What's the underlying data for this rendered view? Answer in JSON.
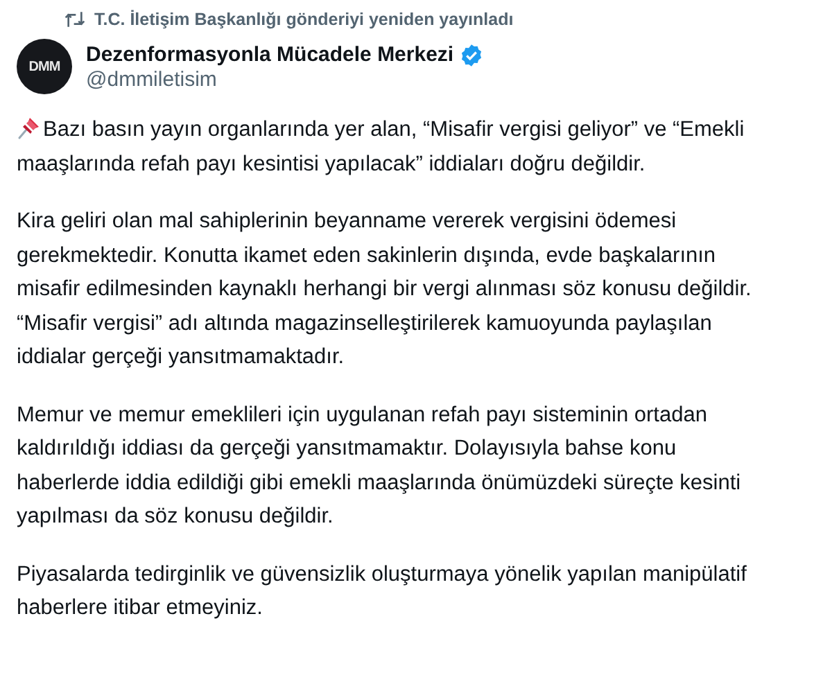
{
  "repost": {
    "text": "T.C. İletişim Başkanlığı gönderiyi yeniden yayınladı"
  },
  "author": {
    "avatar_text": "DMM",
    "name": "Dezenformasyonla Mücadele Merkezi",
    "verified": true,
    "handle": "@dmmiletisim"
  },
  "paragraphs": [
    {
      "pinned": true,
      "text": "Bazı basın yayın organlarında yer alan, “Misafir vergisi geliyor” ve “Emekli maaşlarında refah payı kesintisi yapılacak” iddiaları doğru değildir."
    },
    {
      "pinned": false,
      "text": "Kira geliri olan mal sahiplerinin beyanname vererek vergisini ödemesi gerekmektedir. Konutta ikamet eden sakinlerin dışında, evde başkalarının misafir edilmesinden kaynaklı herhangi bir vergi alınması söz konusu değildir. “Misafir vergisi” adı altında magazinselleştirilerek kamuoyunda paylaşılan iddialar gerçeği yansıtmamaktadır."
    },
    {
      "pinned": false,
      "text": "Memur ve memur emeklileri için uygulanan refah payı sisteminin ortadan kaldırıldığı iddiası da gerçeği yansıtmamaktır. Dolayısıyla bahse konu haberlerde iddia edildiği gibi emekli maaşlarında önümüzdeki süreçte kesinti yapılması da söz konusu değildir."
    },
    {
      "pinned": false,
      "text": "Piyasalarda tedirginlik ve güvensizlik oluşturmaya yönelik yapılan manipülatif haberlere itibar etmeyiniz."
    }
  ]
}
